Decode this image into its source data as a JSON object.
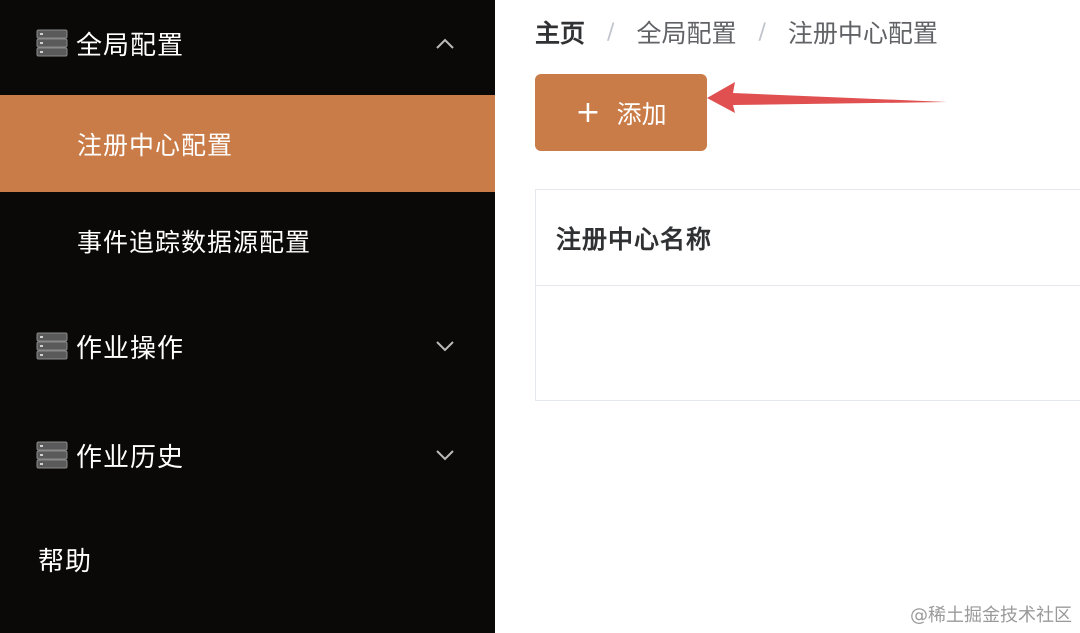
{
  "sidebar": {
    "groups": [
      {
        "label": "全局配置",
        "icon": "server-icon",
        "chevron": "chevron-up-icon"
      },
      {
        "label": "作业操作",
        "icon": "server-icon",
        "chevron": "chevron-down-icon"
      },
      {
        "label": "作业历史",
        "icon": "server-icon",
        "chevron": "chevron-down-icon"
      }
    ],
    "sub_items": [
      {
        "label": "注册中心配置",
        "active": true
      },
      {
        "label": "事件追踪数据源配置",
        "active": false
      }
    ],
    "help_label": "帮助"
  },
  "breadcrumb": {
    "home": "主页",
    "separator": "/",
    "items": [
      "全局配置",
      "注册中心配置"
    ]
  },
  "toolbar": {
    "add_icon": "plus-icon",
    "add_label": "添加"
  },
  "table": {
    "columns": [
      "注册中心名称"
    ],
    "rows": []
  },
  "watermark": "@稀土掘金技术社区",
  "colors": {
    "sidebar_bg": "#0b0907",
    "accent": "#c97c48",
    "arrow": "#e05050"
  }
}
